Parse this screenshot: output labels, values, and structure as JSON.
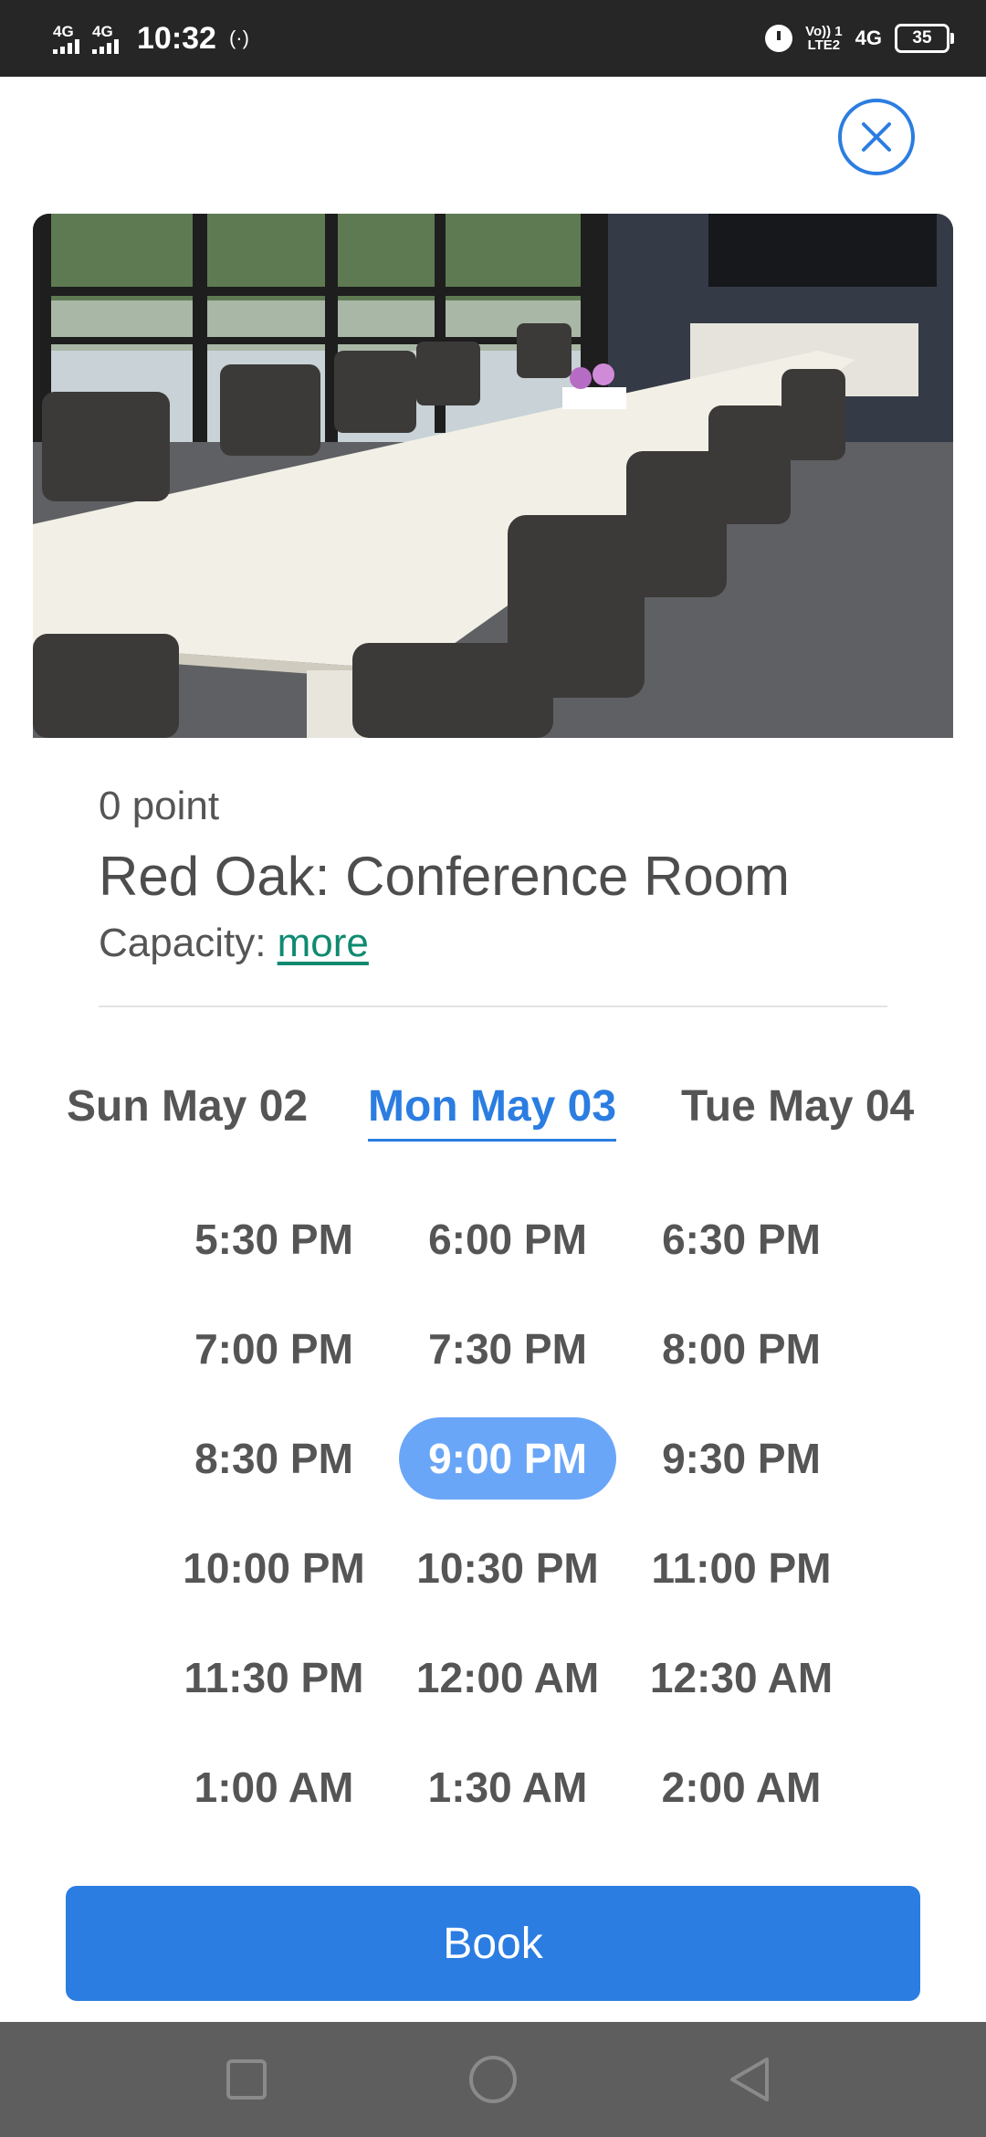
{
  "status_bar": {
    "network1": "4G",
    "network2": "4G",
    "time": "10:32",
    "hotspot_icon": "hotspot-icon",
    "alarm_icon": "alarm-icon",
    "volte_line1": "Vo)) 1",
    "volte_line2": "LTE2",
    "data_network": "4G",
    "battery": "35"
  },
  "close": {
    "icon": "close-icon",
    "color": "#2b7de1"
  },
  "room": {
    "photo": "conference-room-photo",
    "points": "0 point",
    "name": "Red Oak: Conference Room",
    "capacity_label": "Capacity: ",
    "capacity_link": "more"
  },
  "dates": [
    {
      "label": "Sun May 02",
      "active": false
    },
    {
      "label": "Mon May 03",
      "active": true
    },
    {
      "label": "Tue May 04",
      "active": false
    }
  ],
  "time_slots": [
    "5:30 PM",
    "6:00 PM",
    "6:30 PM",
    "7:00 PM",
    "7:30 PM",
    "8:00 PM",
    "8:30 PM",
    "9:00 PM",
    "9:30 PM",
    "10:00 PM",
    "10:30 PM",
    "11:00 PM",
    "11:30 PM",
    "12:00 AM",
    "12:30 AM",
    "1:00 AM",
    "1:30 AM",
    "2:00 AM"
  ],
  "selected_slot": "9:00 PM",
  "book_label": "Book",
  "colors": {
    "accent": "#2b7de1",
    "selected_slot": "#6aa6f8",
    "link": "#0f8a70"
  },
  "nav": {
    "recents_icon": "square-icon",
    "home_icon": "circle-icon",
    "back_icon": "triangle-back-icon"
  }
}
